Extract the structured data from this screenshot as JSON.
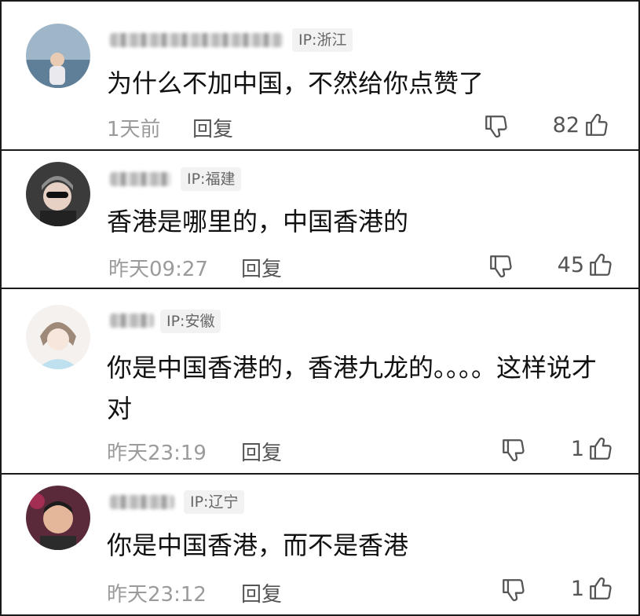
{
  "comments": [
    {
      "ip": "IP:浙江",
      "text": "为什么不加中国，不然给你点赞了",
      "time": "1天前",
      "reply": "回复",
      "likes": "82"
    },
    {
      "ip": "IP:福建",
      "text": "香港是哪里的，中国香港的",
      "time": "昨天09:27",
      "reply": "回复",
      "likes": "45"
    },
    {
      "ip": "IP:安徽",
      "text": "你是中国香港的，香港九龙的。。。。这样说才对",
      "time": "昨天23:19",
      "reply": "回复",
      "likes": "1"
    },
    {
      "ip": "IP:辽宁",
      "text": "你是中国香港，而不是香港",
      "time": "昨天23:12",
      "reply": "回复",
      "likes": "1"
    }
  ],
  "icons": {
    "like": "thumbs-up-outline-icon",
    "dislike": "thumbs-down-outline-icon"
  },
  "colors": {
    "text": "#111111",
    "meta": "#9b9b9b",
    "badge_bg": "#f2f2f2",
    "divider": "#1a1a1a"
  }
}
